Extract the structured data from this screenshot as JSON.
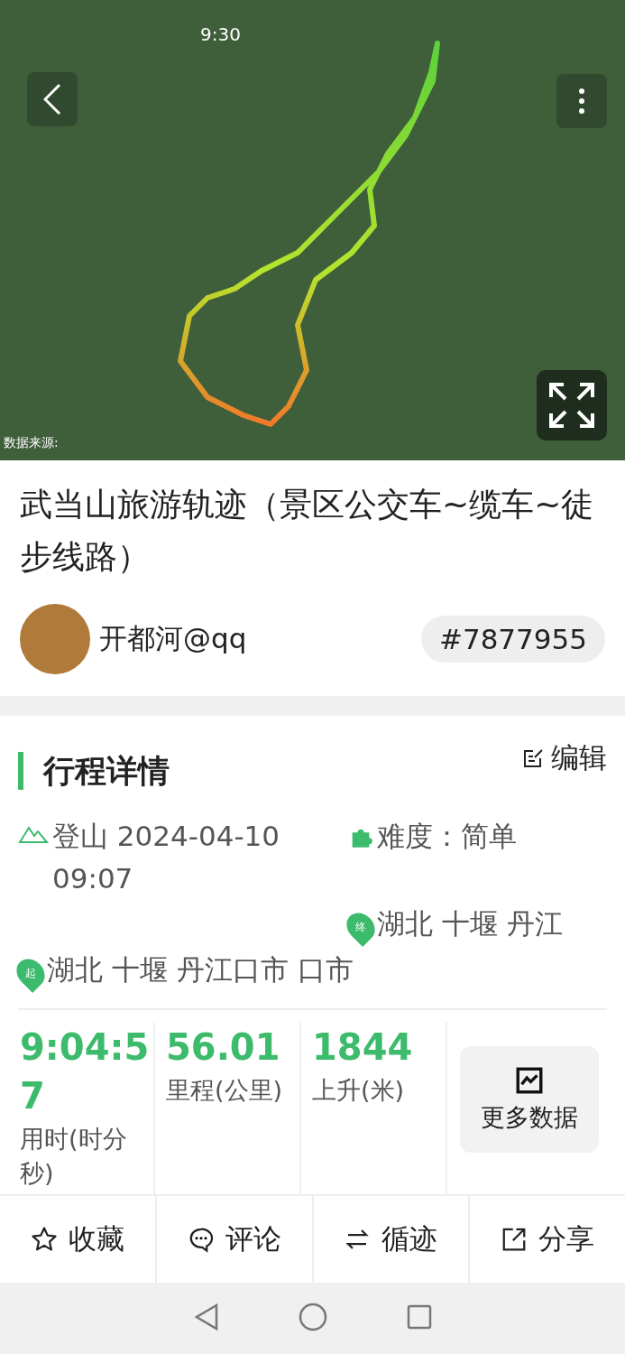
{
  "status_bar": {
    "time": "9:30"
  },
  "map": {
    "attribution": "数据来源:"
  },
  "title": "武当山旅游轨迹（景区公交车~缆车~徒步线路）",
  "author": {
    "name": "开都河@qq",
    "track_id": "#7877955"
  },
  "details": {
    "heading": "行程详情",
    "edit": "编辑",
    "items": [
      {
        "kind": "mountain",
        "text": "登山 2024-04-10 09:07"
      },
      {
        "kind": "difficulty",
        "text": "难度：简单"
      },
      {
        "kind": "end",
        "text": "湖北 十堰 丹江"
      },
      {
        "kind": "start",
        "text": "湖北 十堰 丹江口市 口市"
      }
    ],
    "marker_end": "终",
    "marker_start": "起"
  },
  "stats": [
    {
      "value": "9:04:57",
      "label": "用时(时分秒)"
    },
    {
      "value": "56.01",
      "label": "里程(公里)"
    },
    {
      "value": "1844",
      "label": "上升(米)"
    }
  ],
  "more_button": "更多数据",
  "actions": [
    {
      "kind": "star",
      "label": "收藏"
    },
    {
      "kind": "comment",
      "label": "评论"
    },
    {
      "kind": "loop",
      "label": "循迹"
    },
    {
      "kind": "share",
      "label": "分享"
    }
  ]
}
